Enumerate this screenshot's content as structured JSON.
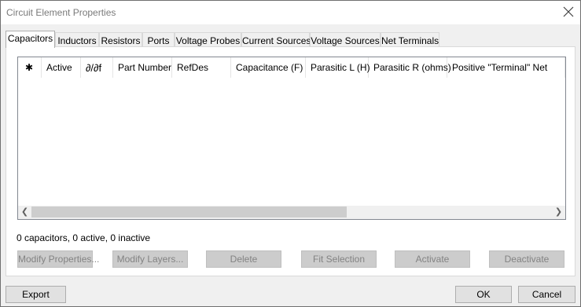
{
  "window": {
    "title": "Circuit Element Properties"
  },
  "tabs": [
    {
      "label": "Capacitors",
      "active": true
    },
    {
      "label": "Inductors"
    },
    {
      "label": "Resistors"
    },
    {
      "label": "Ports"
    },
    {
      "label": "Voltage Probes"
    },
    {
      "label": "Current Sources"
    },
    {
      "label": "Voltage Sources"
    },
    {
      "label": "Net Terminals"
    }
  ],
  "grid": {
    "columns": [
      {
        "label": "✱"
      },
      {
        "label": "Active"
      },
      {
        "label": "∂/∂f"
      },
      {
        "label": "Part Number"
      },
      {
        "label": "RefDes"
      },
      {
        "label": "Capacitance (F)"
      },
      {
        "label": "Parasitic L (H)"
      },
      {
        "label": "Parasitic R (ohms)"
      },
      {
        "label": "Positive \"Terminal\" Net"
      }
    ],
    "rows": []
  },
  "summary": "0 capacitors, 0 active, 0 inactive",
  "actions": {
    "modify_properties": "Modify Properties...",
    "modify_layers": "Modify Layers...",
    "delete": "Delete",
    "fit_selection": "Fit Selection",
    "activate": "Activate",
    "deactivate": "Deactivate"
  },
  "footer": {
    "export": "Export",
    "ok": "OK",
    "cancel": "Cancel"
  },
  "icons": {
    "close": "close-icon",
    "scroll_left": "chevron-left-icon",
    "scroll_right": "chevron-right-icon"
  }
}
